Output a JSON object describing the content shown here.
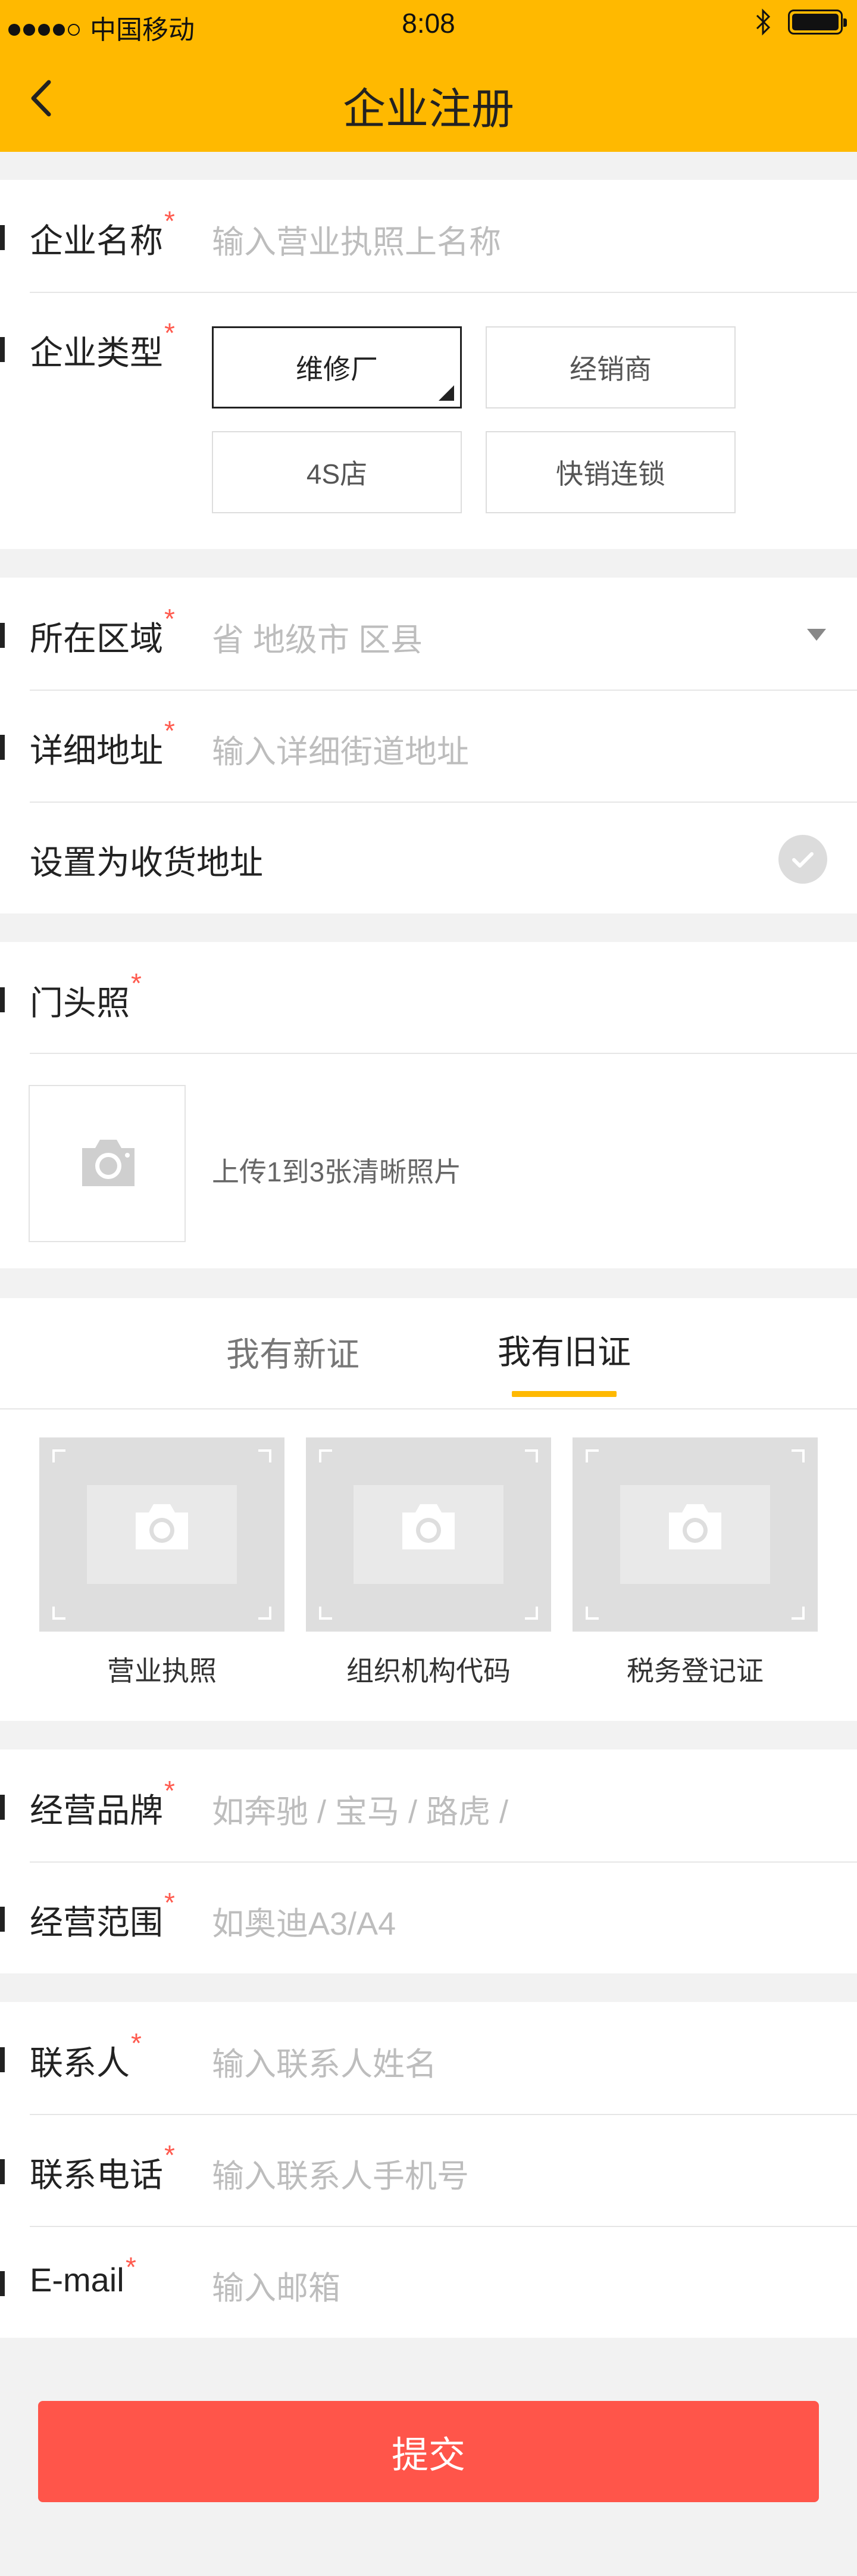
{
  "status_bar": {
    "carrier": "中国移动",
    "time": "8:08",
    "signal_bars": 4,
    "signal_total": 5,
    "icons": [
      "signal-dots-icon",
      "bluetooth-icon",
      "battery-icon"
    ]
  },
  "nav": {
    "title": "企业注册",
    "back_icon": "chevron-left-icon"
  },
  "company": {
    "name_label": "企业名称",
    "name_placeholder": "输入营业执照上名称",
    "type_label": "企业类型",
    "types": [
      "维修厂",
      "经销商",
      "4S店",
      "快销连锁"
    ],
    "selected_type": "维修厂"
  },
  "address": {
    "region_label": "所在区域",
    "region_placeholder": "省 地级市 区县",
    "detail_label": "详细地址",
    "detail_placeholder": "输入详细街道地址",
    "shipping_label": "设置为收货地址"
  },
  "storefront": {
    "label": "门头照",
    "hint": "上传1到3张清晰照片"
  },
  "certificates": {
    "tabs": [
      "我有新证",
      "我有旧证"
    ],
    "active_tab": "我有旧证",
    "items": [
      "营业执照",
      "组织机构代码",
      "税务登记证"
    ]
  },
  "business": {
    "brand_label": "经营品牌",
    "brand_placeholder": "如奔驰 / 宝马 / 路虎 /",
    "scope_label": "经营范围",
    "scope_placeholder": "如奥迪A3/A4"
  },
  "contact": {
    "person_label": "联系人",
    "person_placeholder": "输入联系人姓名",
    "phone_label": "联系电话",
    "phone_placeholder": "输入联系人手机号",
    "email_label": "E-mail",
    "email_placeholder": "输入邮箱"
  },
  "required_mark": "*",
  "submit_label": "提交",
  "colors": {
    "accent": "#ffb900",
    "required": "#ff5a4e",
    "submit": "#ff554a",
    "placeholder": "#bdbdbd"
  }
}
